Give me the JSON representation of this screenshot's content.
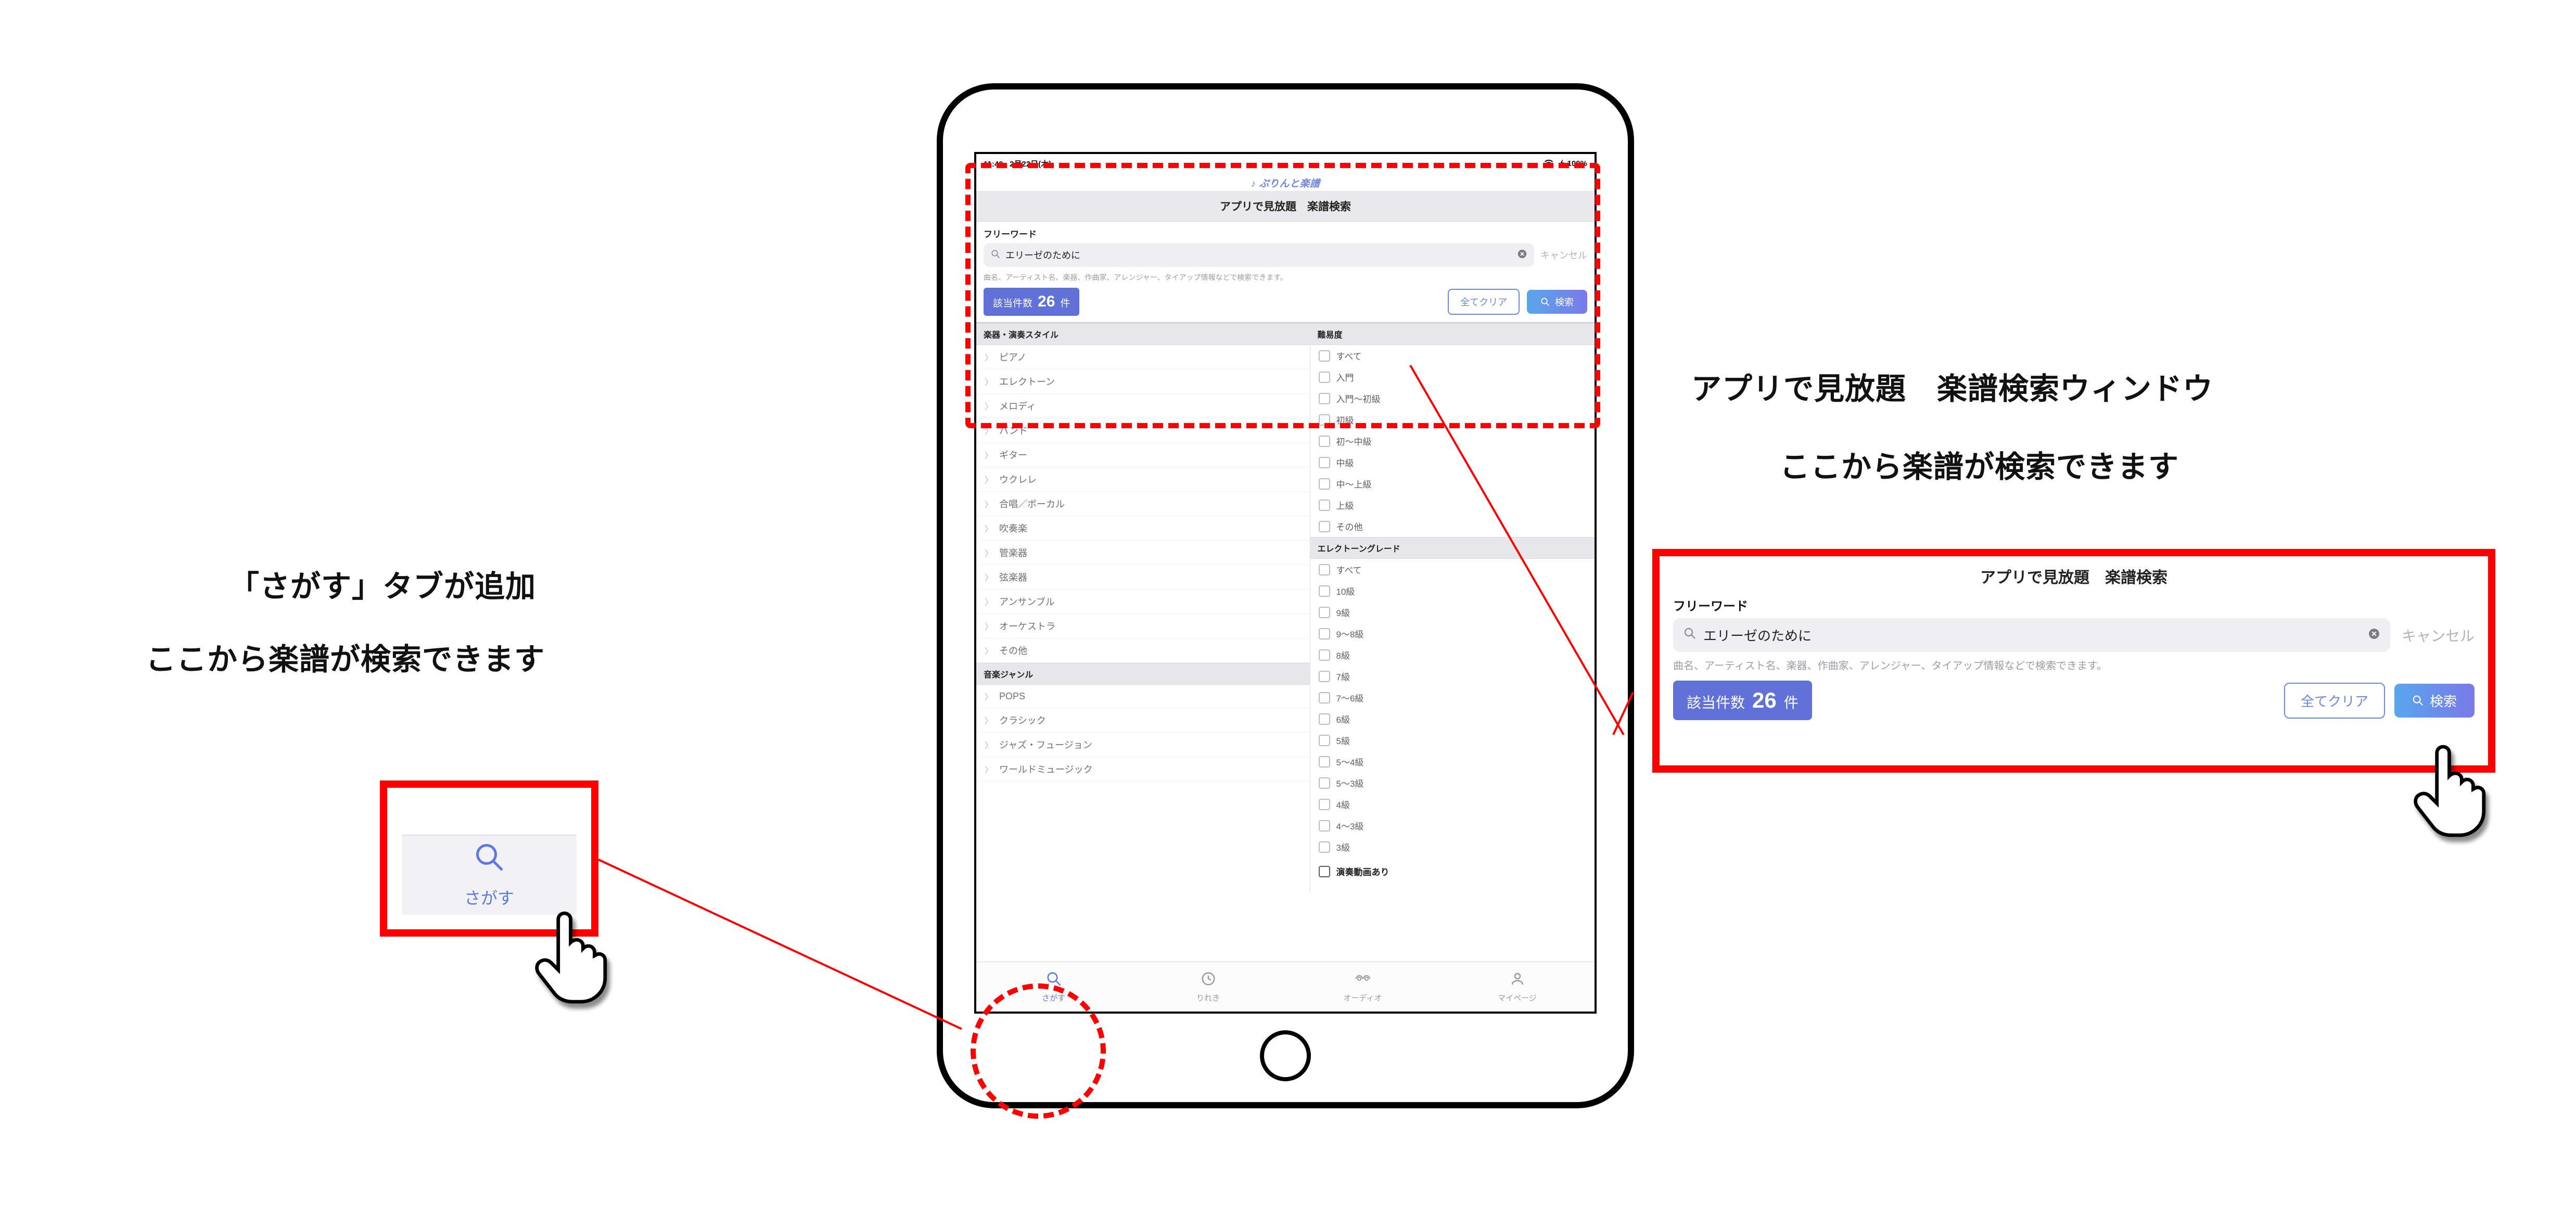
{
  "statusbar": {
    "time": "11:40",
    "date": "2月22日(木)",
    "battery": "100%"
  },
  "app_logo": "♪ ぷりんと楽譜",
  "screen_title": "アプリで見放題　楽譜検索",
  "freeword": {
    "label": "フリーワード",
    "value": "エリーゼのために",
    "cancel": "キャンセル",
    "help": "曲名、アーティスト名、楽器、作曲家、アレンジャー、タイアップ情報などで検索できます。"
  },
  "results": {
    "label": "該当件数",
    "count": "26",
    "unit": "件"
  },
  "buttons": {
    "clear_all": "全てクリア",
    "search": "検索"
  },
  "sections": {
    "instrument_header": "楽器・演奏スタイル",
    "instruments": [
      "ピアノ",
      "エレクトーン",
      "メロディ",
      "バンド",
      "ギター",
      "ウクレレ",
      "合唱／ボーカル",
      "吹奏楽",
      "管楽器",
      "弦楽器",
      "アンサンブル",
      "オーケストラ",
      "その他"
    ],
    "genre_header": "音楽ジャンル",
    "genres": [
      "POPS",
      "クラシック",
      "ジャズ・フュージョン",
      "ワールドミュージック"
    ],
    "difficulty_header": "難易度",
    "difficulty": [
      "すべて",
      "入門",
      "入門～初級",
      "初級",
      "初～中級",
      "中級",
      "中～上級",
      "上級",
      "その他"
    ],
    "grade_header": "エレクトーングレード",
    "grade": [
      "すべて",
      "10級",
      "9級",
      "9～8級",
      "8級",
      "7級",
      "7～6級",
      "6級",
      "5級",
      "5～4級",
      "5～3級",
      "4級",
      "4～3級",
      "3級"
    ],
    "video_label": "演奏動画あり"
  },
  "tabs": {
    "search": "さがす",
    "history": "りれき",
    "audio": "オーディオ",
    "mypage": "マイページ"
  },
  "annotations": {
    "left1": "「さがす」タブが追加",
    "left2": "ここから楽譜が検索できます",
    "right1": "アプリで見放題　楽譜検索ウィンドウ",
    "right2": "ここから楽譜が検索できます"
  },
  "callout_search": {
    "title": "アプリで見放題　楽譜検索",
    "label": "フリーワード",
    "value": "エリーゼのために",
    "cancel": "キャンセル",
    "help": "曲名、アーティスト名、楽器、作曲家、アレンジャー、タイアップ情報などで検索できます。",
    "count_label": "該当件数",
    "count": "26",
    "unit": "件",
    "clear_all": "全てクリア",
    "search": "検索"
  },
  "callout_sagasu": {
    "label": "さがす"
  }
}
